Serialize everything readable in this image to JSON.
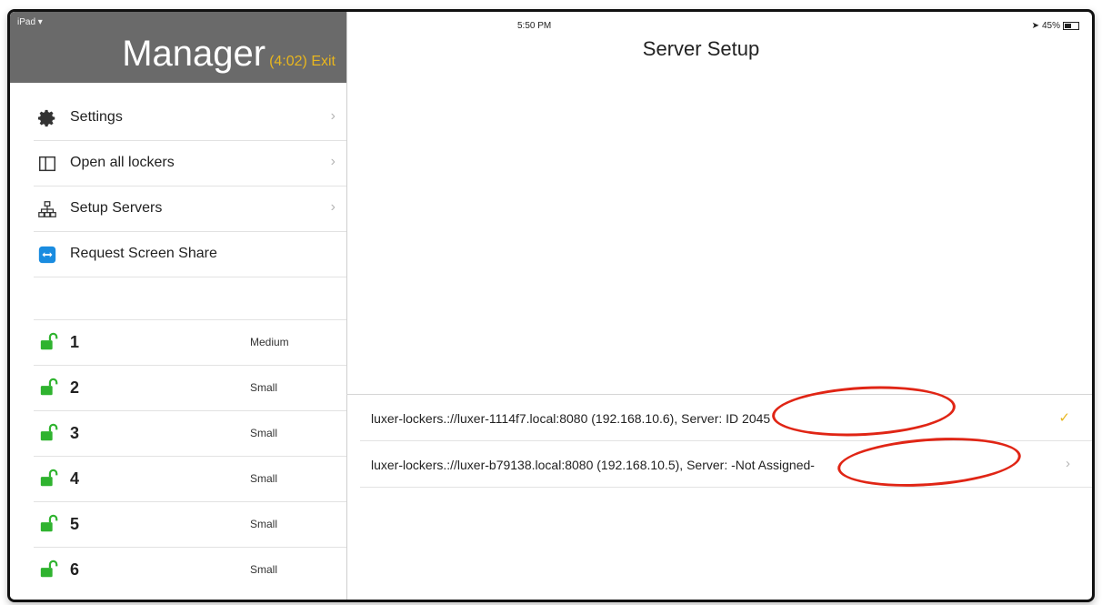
{
  "status": {
    "device": "iPad",
    "time": "5:50 PM",
    "battery": "45%"
  },
  "sidebar": {
    "title": "Manager",
    "timer": "(4:02) Exit",
    "menu": [
      {
        "label": "Settings",
        "icon": "gear-icon"
      },
      {
        "label": "Open all lockers",
        "icon": "locker-icon"
      },
      {
        "label": "Setup Servers",
        "icon": "network-icon"
      },
      {
        "label": "Request Screen Share",
        "icon": "screen-share-icon"
      }
    ],
    "lockers": [
      {
        "number": "1",
        "size": "Medium"
      },
      {
        "number": "2",
        "size": "Small"
      },
      {
        "number": "3",
        "size": "Small"
      },
      {
        "number": "4",
        "size": "Small"
      },
      {
        "number": "5",
        "size": "Small"
      },
      {
        "number": "6",
        "size": "Small"
      }
    ]
  },
  "main": {
    "title": "Server Setup",
    "servers": [
      {
        "address": "luxer-lockers.://luxer-1114f7.local:8080 (192.168.10.6),",
        "server": "Server: ID 2045",
        "accessory": "check"
      },
      {
        "address": "luxer-lockers.://luxer-b79138.local:8080 (192.168.10.5),",
        "server": "Server: -Not Assigned-",
        "accessory": "chevron"
      }
    ]
  },
  "colors": {
    "accent": "#e8b61e",
    "header": "#6a6a6a",
    "annotation": "#e02515",
    "lock": "#2fb32f"
  }
}
